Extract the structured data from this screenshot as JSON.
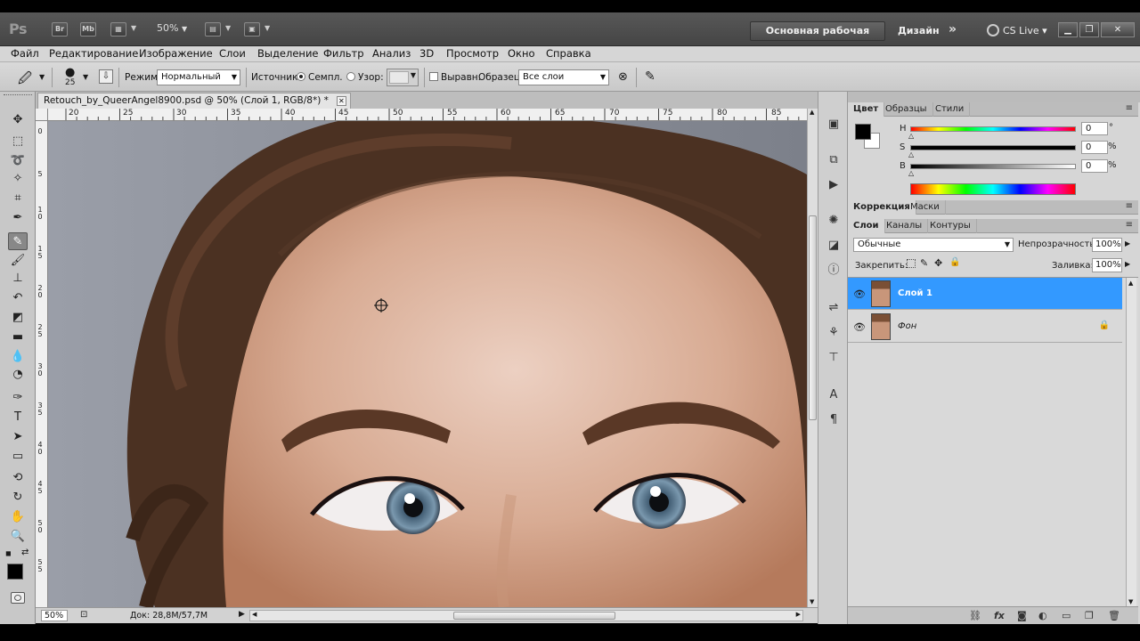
{
  "app": {
    "logo": "Ps",
    "bridge_label": "Br",
    "minibridge_label": "Mb",
    "zoom_dropdown": "50%",
    "workspace_main": "Основная рабочая среда",
    "workspace_design": "Дизайн",
    "workspace_more": "»",
    "cs_live": "CS Live"
  },
  "menu": [
    "Файл",
    "Редактирование",
    "Изображение",
    "Слои",
    "Выделение",
    "Фильтр",
    "Анализ",
    "3D",
    "Просмотр",
    "Окно",
    "Справка"
  ],
  "options": {
    "brush_size": "25",
    "mode_label": "Режим:",
    "mode_value": "Нормальный",
    "source_label": "Источник:",
    "sampled_label": "Семпл.",
    "pattern_label": "Узор:",
    "aligned_label": "Выравн.",
    "sample_label": "Образец:",
    "sample_value": "Все слои",
    "source_selected": "sampled"
  },
  "document": {
    "tab_title": "Retouch_by_QueerAngel8900.psd @ 50% (Слой 1, RGB/8*) *",
    "ruler_h": [
      "20",
      "25",
      "30",
      "35",
      "40",
      "45",
      "50",
      "55",
      "60",
      "65",
      "70",
      "75",
      "80",
      "85"
    ],
    "ruler_v": [
      "0",
      "5",
      "1 0",
      "1 5",
      "2 0",
      "2 5",
      "3 0",
      "3 5",
      "4 0",
      "4 5",
      "5 0",
      "5 5"
    ],
    "zoom": "50%",
    "doc_info": "Док: 28,8M/57,7M"
  },
  "color_panel": {
    "tabs": [
      "Цвет",
      "Образцы",
      "Стили"
    ],
    "h_label": "H",
    "h_value": "0",
    "h_unit": "°",
    "s_label": "S",
    "s_value": "0",
    "s_unit": "%",
    "b_label": "B",
    "b_value": "0",
    "b_unit": "%",
    "foreground": "#000000",
    "background": "#ffffff"
  },
  "adjust_panel": {
    "tabs": [
      "Коррекция",
      "Маски"
    ]
  },
  "layers_panel": {
    "tabs": [
      "Слои",
      "Каналы",
      "Контуры"
    ],
    "blend_mode": "Обычные",
    "opacity_label": "Непрозрачность:",
    "opacity_value": "100%",
    "lock_label": "Закрепить:",
    "fill_label": "Заливка:",
    "fill_value": "100%",
    "layers": [
      {
        "name": "Слой 1",
        "selected": true,
        "visible": true,
        "locked": false
      },
      {
        "name": "Фон",
        "selected": false,
        "visible": true,
        "locked": true
      }
    ]
  },
  "colors": {
    "selection": "#3399ff",
    "chrome_dark": "#454545",
    "panel_bg": "#d6d6d6"
  }
}
